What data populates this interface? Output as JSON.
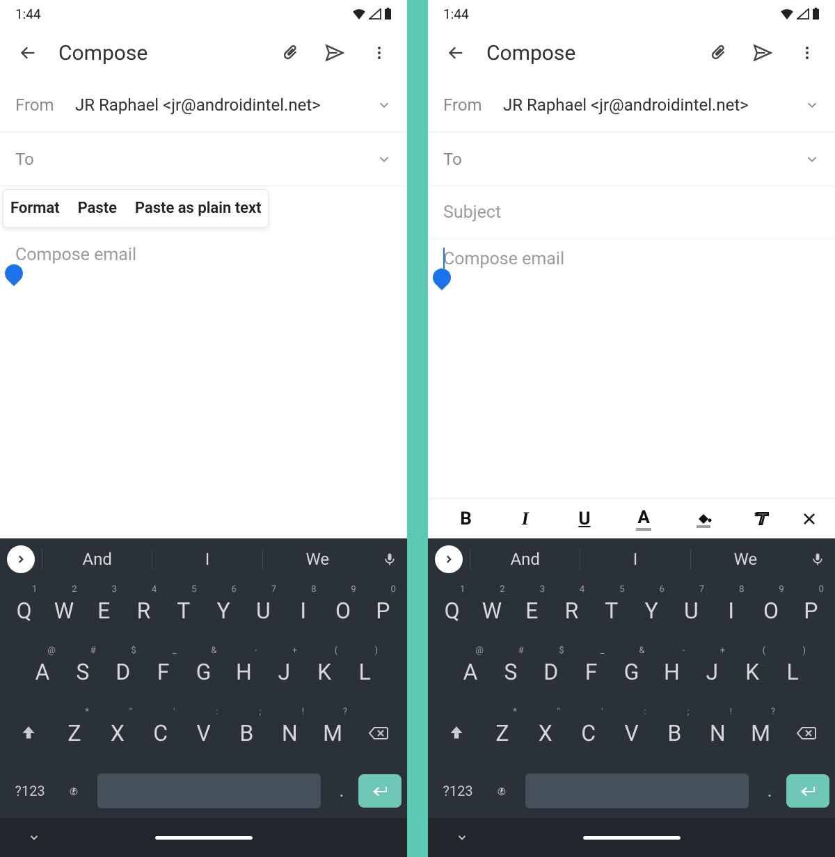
{
  "statusbar": {
    "time": "1:44"
  },
  "appbar": {
    "title": "Compose"
  },
  "fields": {
    "from_label": "From",
    "from_value": "JR Raphael <jr@androidintel.net>",
    "to_label": "To",
    "subject_placeholder": "Subject",
    "body_placeholder": "Compose email"
  },
  "context_menu": {
    "format": "Format",
    "paste": "Paste",
    "paste_plain": "Paste as plain text"
  },
  "format_bar": {
    "bold": "B",
    "italic": "I",
    "underline": "U",
    "textcolor": "A"
  },
  "suggestions": {
    "s1": "And",
    "s2": "I",
    "s3": "We"
  },
  "keyboard": {
    "row1": [
      {
        "k": "Q",
        "s": "1"
      },
      {
        "k": "W",
        "s": "2"
      },
      {
        "k": "E",
        "s": "3"
      },
      {
        "k": "R",
        "s": "4"
      },
      {
        "k": "T",
        "s": "5"
      },
      {
        "k": "Y",
        "s": "6"
      },
      {
        "k": "U",
        "s": "7"
      },
      {
        "k": "I",
        "s": "8"
      },
      {
        "k": "O",
        "s": "9"
      },
      {
        "k": "P",
        "s": "0"
      }
    ],
    "row2": [
      {
        "k": "A",
        "s": "@"
      },
      {
        "k": "S",
        "s": "#"
      },
      {
        "k": "D",
        "s": "$"
      },
      {
        "k": "F",
        "s": "_"
      },
      {
        "k": "G",
        "s": "&"
      },
      {
        "k": "H",
        "s": "-"
      },
      {
        "k": "J",
        "s": "+"
      },
      {
        "k": "K",
        "s": "("
      },
      {
        "k": "L",
        "s": ")"
      }
    ],
    "row3": [
      {
        "k": "Z",
        "s": "*"
      },
      {
        "k": "X",
        "s": "\""
      },
      {
        "k": "C",
        "s": "'"
      },
      {
        "k": "V",
        "s": ":"
      },
      {
        "k": "B",
        "s": ";"
      },
      {
        "k": "N",
        "s": "!"
      },
      {
        "k": "M",
        "s": "?"
      }
    ],
    "symkey": "?123",
    "period": "."
  }
}
